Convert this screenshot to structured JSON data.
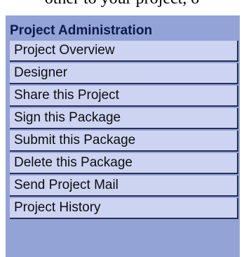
{
  "page": {
    "top_text": "other to your project, o"
  },
  "nav": {
    "title": "Project Administration",
    "items": [
      {
        "label": "Project Overview"
      },
      {
        "label": "Designer"
      },
      {
        "label": "Share this Project"
      },
      {
        "label": "Sign this Package"
      },
      {
        "label": "Submit this Package"
      },
      {
        "label": "Delete this Package"
      },
      {
        "label": "Send Project Mail"
      },
      {
        "label": "Project History"
      }
    ]
  },
  "colors": {
    "panel_background": "#93a3d6",
    "item_background": "#cdd4f2",
    "title_text": "#0c1a4a",
    "item_border": "#2a2f55"
  }
}
